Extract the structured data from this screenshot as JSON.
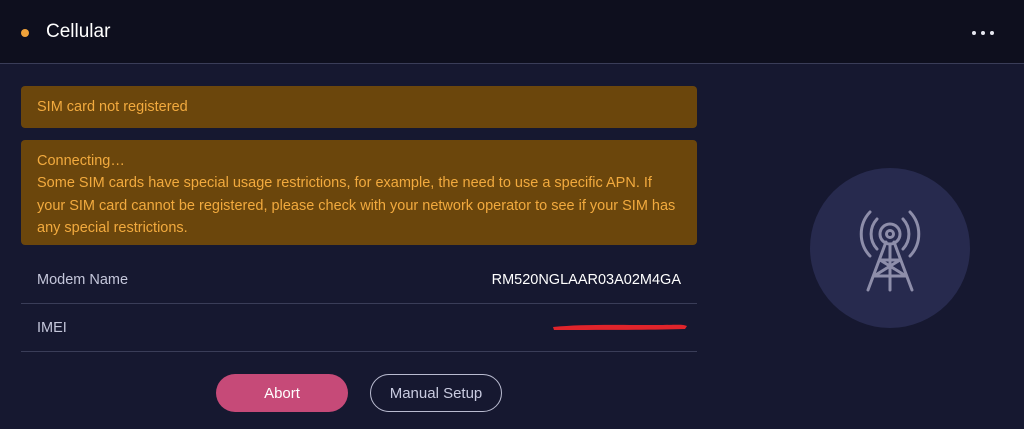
{
  "header": {
    "title": "Cellular",
    "status_color": "#f0a23a",
    "menu_icon": "more-horizontal-icon"
  },
  "alerts": {
    "registration": "SIM card not registered",
    "connecting_title": "Connecting…",
    "connecting_message": "Some SIM cards have special usage restrictions, for example, the need to use a specific APN. If your SIM card cannot be registered, please check with your network operator to see if your SIM has any special restrictions."
  },
  "info": {
    "modem_label": "Modem Name",
    "modem_value": "RM520NGLAAR03A02M4GA",
    "imei_label": "IMEI"
  },
  "buttons": {
    "abort": "Abort",
    "manual_setup": "Manual Setup"
  },
  "illustration": {
    "icon": "cell-tower-icon"
  },
  "colors": {
    "accent": "#c64a78",
    "warning_bg": "#6b460c",
    "warning_text": "#f2aa3e",
    "background": "#161830"
  }
}
